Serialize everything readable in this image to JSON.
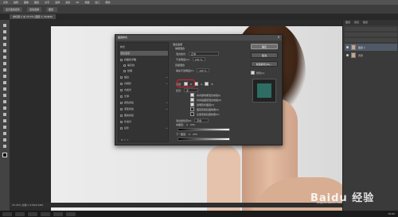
{
  "menubar": {
    "items": [
      "文件",
      "编辑",
      "图像",
      "图层",
      "文字",
      "选择",
      "滤镜",
      "3D",
      "视图",
      "窗口",
      "帮助"
    ]
  },
  "optionbar": {
    "buttons": [
      "显示变换控件",
      "自动选择",
      "图层"
    ]
  },
  "document_tab": {
    "label": "未标题-1 @ 33.3% (图层 1, RGB/8)"
  },
  "layers_panel": {
    "tabs": [
      "图层",
      "通道",
      "路径"
    ],
    "layers": [
      {
        "name": "图层 1",
        "active": true
      },
      {
        "name": "背景",
        "active": false
      }
    ]
  },
  "dialog": {
    "title": "图层样式",
    "close_symbol": "×",
    "style_list": [
      {
        "label": "样式",
        "checkbox": false,
        "selected": false,
        "plus": false
      },
      {
        "label": "混合选项",
        "checkbox": false,
        "selected": true,
        "plus": false
      },
      {
        "label": "斜面和浮雕",
        "checkbox": true,
        "selected": false,
        "plus": false
      },
      {
        "label": "等高线",
        "checkbox": true,
        "selected": false,
        "plus": false
      },
      {
        "label": "纹理",
        "checkbox": true,
        "selected": false,
        "plus": false
      },
      {
        "label": "描边",
        "checkbox": true,
        "selected": false,
        "plus": true
      },
      {
        "label": "内阴影",
        "checkbox": true,
        "selected": false,
        "plus": true
      },
      {
        "label": "内发光",
        "checkbox": true,
        "selected": false,
        "plus": false
      },
      {
        "label": "光泽",
        "checkbox": true,
        "selected": false,
        "plus": false
      },
      {
        "label": "颜色叠加",
        "checkbox": true,
        "selected": false,
        "plus": true
      },
      {
        "label": "渐变叠加",
        "checkbox": true,
        "selected": false,
        "plus": true
      },
      {
        "label": "图案叠加",
        "checkbox": true,
        "selected": false,
        "plus": false
      },
      {
        "label": "外发光",
        "checkbox": true,
        "selected": false,
        "plus": false
      },
      {
        "label": "投影",
        "checkbox": true,
        "selected": false,
        "plus": true
      }
    ],
    "list_footer": "fx ⇧ ⇩",
    "settings": {
      "group_general": "混合选项",
      "group_general_sub": "常规混合",
      "blend_mode_label": "混合模式:",
      "blend_mode_value": "正常",
      "opacity_label": "不透明度(O):",
      "opacity_value": "100 %",
      "group_advanced": "高级混合",
      "fill_opacity_label": "填充不透明度(F):",
      "fill_opacity_value": "100 %",
      "channels_label": "通道:",
      "channel_r": "R",
      "channel_g": "G",
      "channel_b": "B",
      "knockout_label": "挖空:",
      "knockout_value": "无",
      "opt1": "将内部效果混合成组(I)",
      "opt2": "将剪贴图层混合成组(P)",
      "opt3": "透明形状图层(T)",
      "opt4": "图层蒙版隐藏效果(S)",
      "opt5": "矢量蒙版隐藏效果(H)",
      "blend_if_label": "混合颜色带(E):",
      "blend_if_value": "灰色",
      "this_layer_label": "本图层:",
      "this_layer_min": "0",
      "this_layer_max": "255",
      "under_layer_label": "下一图层:",
      "under_layer_min": "0",
      "under_layer_max": "255"
    },
    "buttons": {
      "ok": "确定",
      "cancel": "取消",
      "new_style": "新建样式(W)...",
      "preview_label": "预览(V)"
    },
    "preview_color": "#2e6d64",
    "highlight_color": "#e0202c"
  },
  "statusbar": {
    "text": "33.33%   文档:1.37M/2.56M"
  },
  "taskbar": {
    "clock": "15:02"
  },
  "watermark": {
    "logo": "Baidu 经验",
    "url": "jingyan.baidu.com"
  }
}
